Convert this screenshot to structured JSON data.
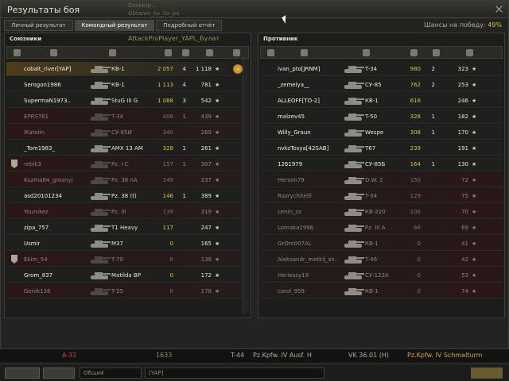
{
  "window": {
    "title": "Результаты боя"
  },
  "ghost": {
    "line1": "Desktop...",
    "line2": "Obtanet_by_ko_pa",
    "line3": "AttackProPlayer_YAPL_Булат"
  },
  "tabs": [
    {
      "label": "Личный результат",
      "active": false
    },
    {
      "label": "Командный результат",
      "active": true
    },
    {
      "label": "Подробный отчёт",
      "active": false
    }
  ],
  "win_chance": {
    "label": "Шансы на победу:",
    "value": "49%"
  },
  "allies": {
    "title": "Союзники",
    "rows": [
      {
        "name": "cobalt_river[YAP]",
        "vehicle": "КВ-1",
        "damage": "2 057",
        "frags": "4",
        "xp": "1 118",
        "state": "own",
        "award": true
      },
      {
        "name": "Serogon1986",
        "vehicle": "КВ-1",
        "damage": "1 113",
        "frags": "4",
        "xp": "781",
        "state": "alive"
      },
      {
        "name": "SupermaN1973..",
        "vehicle": "StuG III G",
        "damage": "1 088",
        "frags": "3",
        "xp": "542",
        "state": "alive"
      },
      {
        "name": "EPRST61",
        "vehicle": "T-34",
        "damage": "406",
        "frags": "1",
        "xp": "439",
        "state": "dead"
      },
      {
        "name": "lKatelin",
        "vehicle": "СУ-85И",
        "damage": "340",
        "frags": "",
        "xp": "269",
        "state": "dead"
      },
      {
        "name": "_Tom1983_",
        "vehicle": "AMX 13 AM",
        "damage": "328",
        "frags": "1",
        "xp": "261",
        "state": "alive"
      },
      {
        "name": "rebik3",
        "vehicle": "Pz. I C",
        "damage": "157",
        "frags": "1",
        "xp": "307",
        "state": "dead",
        "medal": true
      },
      {
        "name": "Kuzma84_groznyj",
        "vehicle": "Pz. 38 nA",
        "damage": "149",
        "frags": "",
        "xp": "237",
        "state": "dead"
      },
      {
        "name": "asd20101234",
        "vehicle": "Pz. 38 (t)",
        "damage": "146",
        "frags": "1",
        "xp": "389",
        "state": "alive"
      },
      {
        "name": "Yourokez",
        "vehicle": "Pz. III",
        "damage": "139",
        "frags": "",
        "xp": "319",
        "state": "dead"
      },
      {
        "name": "zipa_757",
        "vehicle": "T1 Heavy",
        "damage": "117",
        "frags": "",
        "xp": "247",
        "state": "alive"
      },
      {
        "name": "Usmir",
        "vehicle": "M37",
        "damage": "0",
        "frags": "",
        "xp": "165",
        "state": "alive"
      },
      {
        "name": "Ekim_54",
        "vehicle": "T-70",
        "damage": "0",
        "frags": "",
        "xp": "138",
        "state": "dead",
        "medal": true
      },
      {
        "name": "Grom_837",
        "vehicle": "Matilda BP",
        "damage": "0",
        "frags": "",
        "xp": "172",
        "state": "alive"
      },
      {
        "name": "Genik136",
        "vehicle": "T-25",
        "damage": "0",
        "frags": "",
        "xp": "178",
        "state": "dead"
      }
    ]
  },
  "enemies": {
    "title": "Противник",
    "rows": [
      {
        "name": "ivan_pto[JRNM]",
        "vehicle": "T-34",
        "damage": "980",
        "frags": "2",
        "xp": "323"
      },
      {
        "name": "_zemelya__",
        "vehicle": "СУ-85",
        "damage": "762",
        "frags": "2",
        "xp": "253"
      },
      {
        "name": "ALLEOFF[TO-2]",
        "vehicle": "КВ-1",
        "damage": "616",
        "frags": "",
        "xp": "246"
      },
      {
        "name": "malzev45",
        "vehicle": "T-50",
        "damage": "328",
        "frags": "1",
        "xp": "182"
      },
      {
        "name": "Willy_Graun",
        "vehicle": "Wespe",
        "damage": "308",
        "frags": "1",
        "xp": "170"
      },
      {
        "name": "nvkzTosya[42SAB]",
        "vehicle": "T67",
        "damage": "239",
        "frags": "",
        "xp": "191"
      },
      {
        "name": "1261979",
        "vehicle": "СУ-85Б",
        "damage": "164",
        "frags": "1",
        "xp": "130"
      },
      {
        "name": "Herson79",
        "vehicle": "D.W. 2",
        "damage": "150",
        "frags": "",
        "xp": "72"
      },
      {
        "name": "Razrychitelll",
        "vehicle": "T-34",
        "damage": "129",
        "frags": "",
        "xp": "75"
      },
      {
        "name": "Lenin_zx",
        "vehicle": "КВ-220",
        "damage": "106",
        "frags": "",
        "xp": "70"
      },
      {
        "name": "Lomaka1996",
        "vehicle": "Pz. III A",
        "damage": "66",
        "frags": "",
        "xp": "69"
      },
      {
        "name": "GrOm007AL",
        "vehicle": "КВ-1",
        "damage": "0",
        "frags": "",
        "xp": "41"
      },
      {
        "name": "Aleksandr_metkij_sn..",
        "vehicle": "T-46",
        "damage": "0",
        "frags": "",
        "xp": "42"
      },
      {
        "name": "Heriessy19",
        "vehicle": "СУ-122А",
        "damage": "0",
        "frags": "",
        "xp": "53"
      },
      {
        "name": "corol_959",
        "vehicle": "КВ-1",
        "damage": "0",
        "frags": "",
        "xp": "74"
      }
    ]
  },
  "ticker": [
    {
      "text": "A-32",
      "color": "#c44a3a"
    },
    {
      "text": "1633",
      "color": "#7fa04a"
    },
    {
      "text": "T-44",
      "color": "#aeab9c"
    },
    {
      "text": "Pz.Kpfw. IV Ausf. H",
      "color": "#aeab9c"
    },
    {
      "text": "VK 36.01 (H)",
      "color": "#aeab9c"
    },
    {
      "text": "Pz.Kpfw. IV Schmalturm",
      "color": "#d9a34a"
    }
  ],
  "bottom": {
    "channel": "Общий",
    "chat_value": "[YAP]"
  },
  "colors": {
    "accent": "#d9c33c",
    "own_row": "#4f3d1b",
    "dead_row": "#2b1616"
  }
}
